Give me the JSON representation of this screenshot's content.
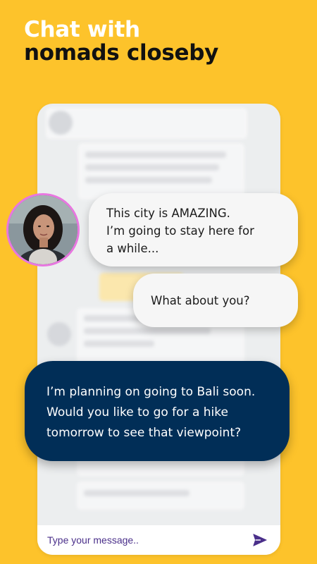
{
  "headline": {
    "line1": "Chat with",
    "line2": "nomads closeby"
  },
  "chat": {
    "messages": [
      {
        "direction": "incoming",
        "text": "This city is AMAZING.\nI’m going to stay here for\na while..."
      },
      {
        "direction": "incoming",
        "text": "What about you?"
      },
      {
        "direction": "outgoing",
        "text": "I’m planning on going to Bali soon.\nWould you like to go for a hike\ntomorrow to see that viewpoint?"
      }
    ]
  },
  "composer": {
    "placeholder": "Type your message..",
    "send_icon": "send-icon"
  },
  "colors": {
    "background": "#fdc32b",
    "headline_primary": "#ffffff",
    "headline_secondary": "#111111",
    "outgoing_bubble": "#012e57",
    "incoming_bubble": "#f6f6f6",
    "avatar_border": "#e877e0",
    "send_icon": "#4a2f8a"
  }
}
